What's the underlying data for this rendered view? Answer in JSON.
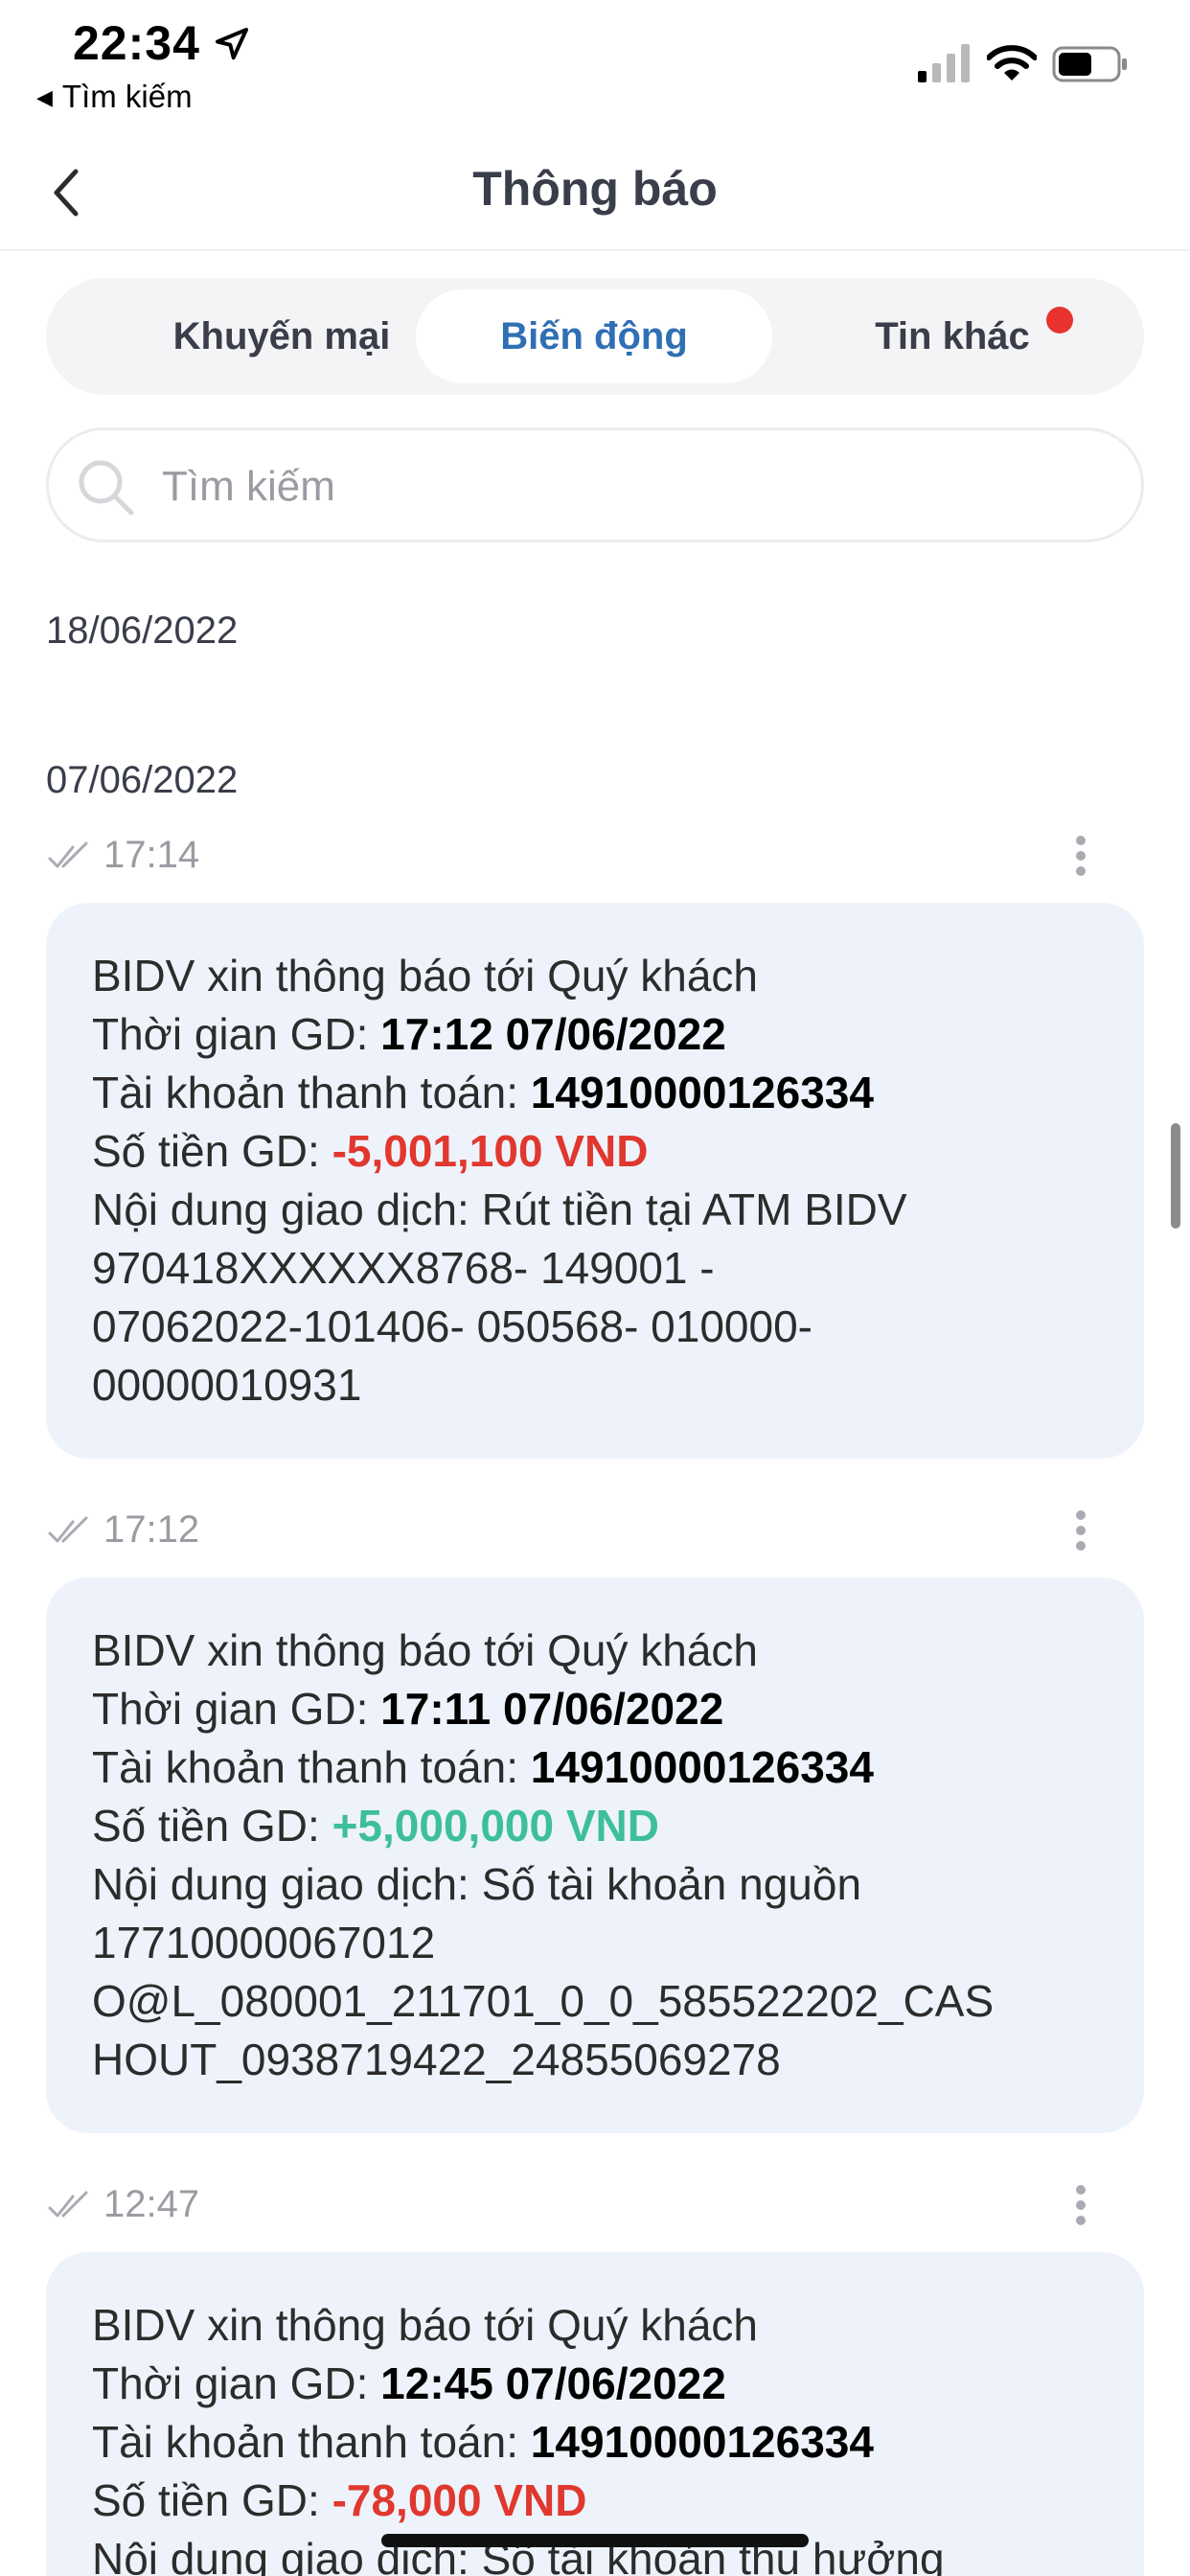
{
  "status_bar": {
    "time": "22:34",
    "back_app": "Tìm kiếm"
  },
  "header": {
    "title": "Thông báo"
  },
  "tabs": [
    {
      "label": "Khuyến mại",
      "active": false
    },
    {
      "label": "Biến động",
      "active": true
    },
    {
      "label": "Tin khác",
      "active": false,
      "has_badge": true
    }
  ],
  "search": {
    "placeholder": "Tìm kiếm"
  },
  "dates": [
    "18/06/2022",
    "07/06/2022"
  ],
  "messages": [
    {
      "time": "17:14",
      "heading": "BIDV xin thông báo tới Quý khách",
      "tx_time_label": "Thời gian GD: ",
      "tx_time": "17:12 07/06/2022",
      "account_label": "Tài khoản thanh toán: ",
      "account": "14910000126334",
      "amount_label": "Số tiền GD: ",
      "amount": "-5,001,100 VND",
      "content_lines": [
        "Nội dung giao dịch: Rút tiền tại ATM BIDV",
        "970418XXXXXX8768- 149001 -",
        "07062022-101406- 050568- 010000-",
        "00000010931"
      ]
    },
    {
      "time": "17:12",
      "heading": "BIDV xin thông báo tới Quý khách",
      "tx_time_label": "Thời gian GD: ",
      "tx_time": "17:11 07/06/2022",
      "account_label": "Tài khoản thanh toán: ",
      "account": "14910000126334",
      "amount_label": "Số tiền GD: ",
      "amount": "+5,000,000 VND",
      "content_lines": [
        "Nội dung giao dịch: Số tài khoản nguồn",
        "17710000067012",
        "O@L_080001_211701_0_0_585522202_CAS",
        "HOUT_0938719422_24855069278"
      ]
    },
    {
      "time": "12:47",
      "heading": "BIDV xin thông báo tới Quý khách",
      "tx_time_label": "Thời gian GD: ",
      "tx_time": "12:45 07/06/2022",
      "account_label": "Tài khoản thanh toán: ",
      "account": "14910000126334",
      "amount_label": "Số tiền GD: ",
      "amount": "-78,000 VND",
      "content_lines": [
        "Nội dung giao dịch: Số tài khoản thụ hưởng"
      ]
    }
  ],
  "colors": {
    "accent": "#2f6fb3",
    "negative": "#e0382f",
    "positive": "#3dbf9a",
    "card_bg": "#eef3fb",
    "badge": "#e8332f"
  },
  "icons": [
    "location-arrow-icon",
    "signal-icon",
    "wifi-icon",
    "battery-icon",
    "back-chevron-icon",
    "search-icon",
    "double-check-icon",
    "more-vertical-icon"
  ]
}
